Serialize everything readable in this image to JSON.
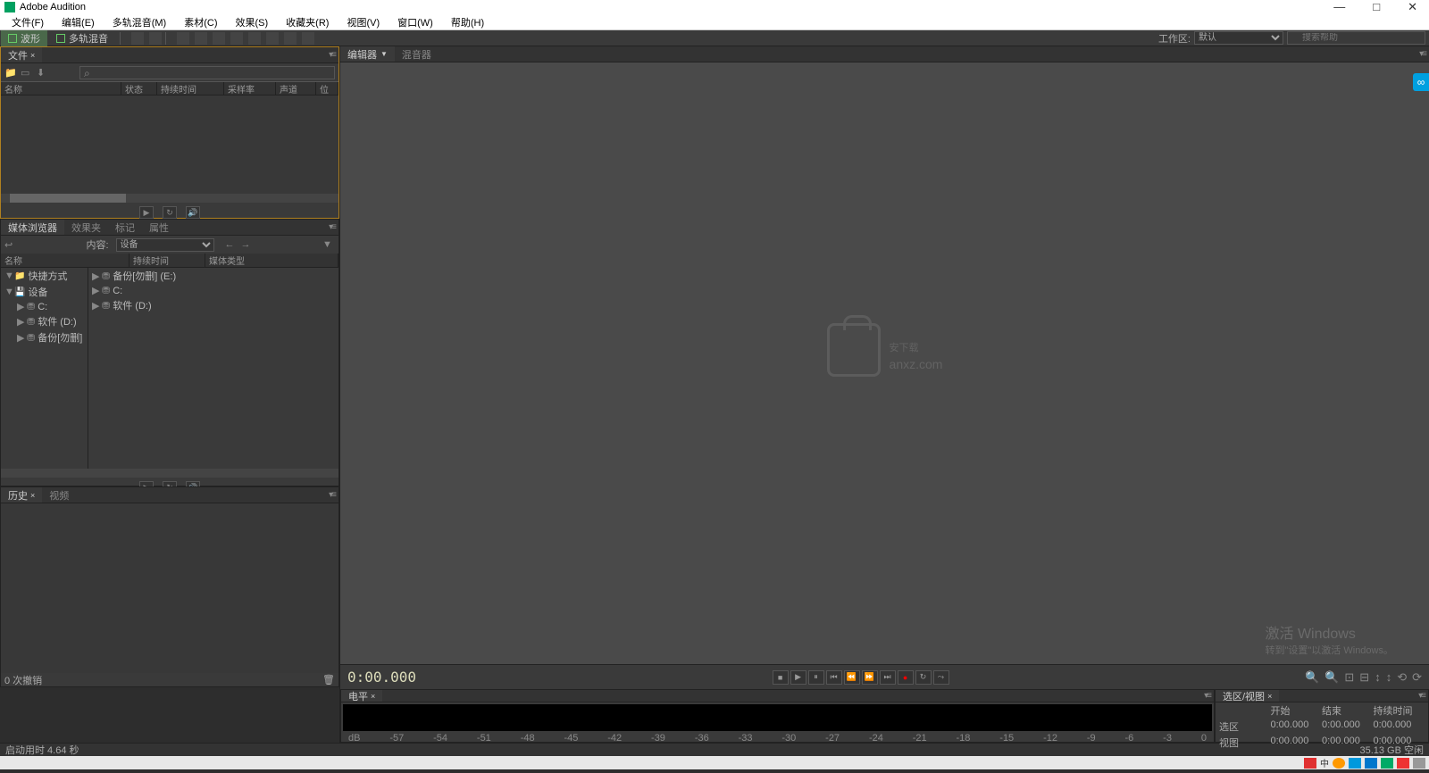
{
  "app": {
    "title": "Adobe Audition"
  },
  "menu": [
    "文件(F)",
    "编辑(E)",
    "多轨混音(M)",
    "素材(C)",
    "效果(S)",
    "收藏夹(R)",
    "视图(V)",
    "窗口(W)",
    "帮助(H)"
  ],
  "modes": {
    "waveform": "波形",
    "multitrack": "多轨混音"
  },
  "workspace": {
    "label": "工作区:",
    "value": "默认"
  },
  "search": {
    "placeholder": "搜索帮助"
  },
  "panels": {
    "files": {
      "tab": "文件",
      "headers": [
        "名称",
        "状态",
        "持续时间",
        "采样率",
        "声道",
        "位"
      ]
    },
    "browser": {
      "tabs": [
        "媒体浏览器",
        "效果夹",
        "标记",
        "属性"
      ],
      "content_label": "内容:",
      "content_value": "设备",
      "headers": [
        "名称",
        "持续时间",
        "媒体类型"
      ],
      "tree_left": [
        "快捷方式",
        "设备",
        "C:",
        "软件 (D:)",
        "备份[勿删]"
      ],
      "tree_right": [
        "备份[勿删] (E:)",
        "C:",
        "软件 (D:)"
      ]
    },
    "history": {
      "tabs": [
        "历史",
        "视频"
      ],
      "status": "0 次撤销"
    },
    "editor": {
      "tabs": [
        "编辑器",
        "混音器"
      ]
    },
    "levels": {
      "tab": "电平",
      "scale": [
        "dB",
        "-57",
        "-54",
        "-51",
        "-48",
        "-45",
        "-42",
        "-39",
        "-36",
        "-33",
        "-30",
        "-27",
        "-24",
        "-21",
        "-18",
        "-15",
        "-12",
        "-9",
        "-6",
        "-3",
        "0"
      ]
    },
    "selview": {
      "tab": "选区/视图",
      "cols": [
        "",
        "开始",
        "结束",
        "持续时间"
      ],
      "rows": [
        "选区",
        "视图"
      ],
      "time": "0:00.000"
    }
  },
  "timecode": "0:00.000",
  "watermark": {
    "main": "安下载",
    "sub": "anxz.com"
  },
  "windows_activate": {
    "line1": "激活 Windows",
    "line2": "转到\"设置\"以激活 Windows。"
  },
  "status": {
    "startup": "启动用时 4.64 秒",
    "space": "35.13 GB 空闲"
  }
}
